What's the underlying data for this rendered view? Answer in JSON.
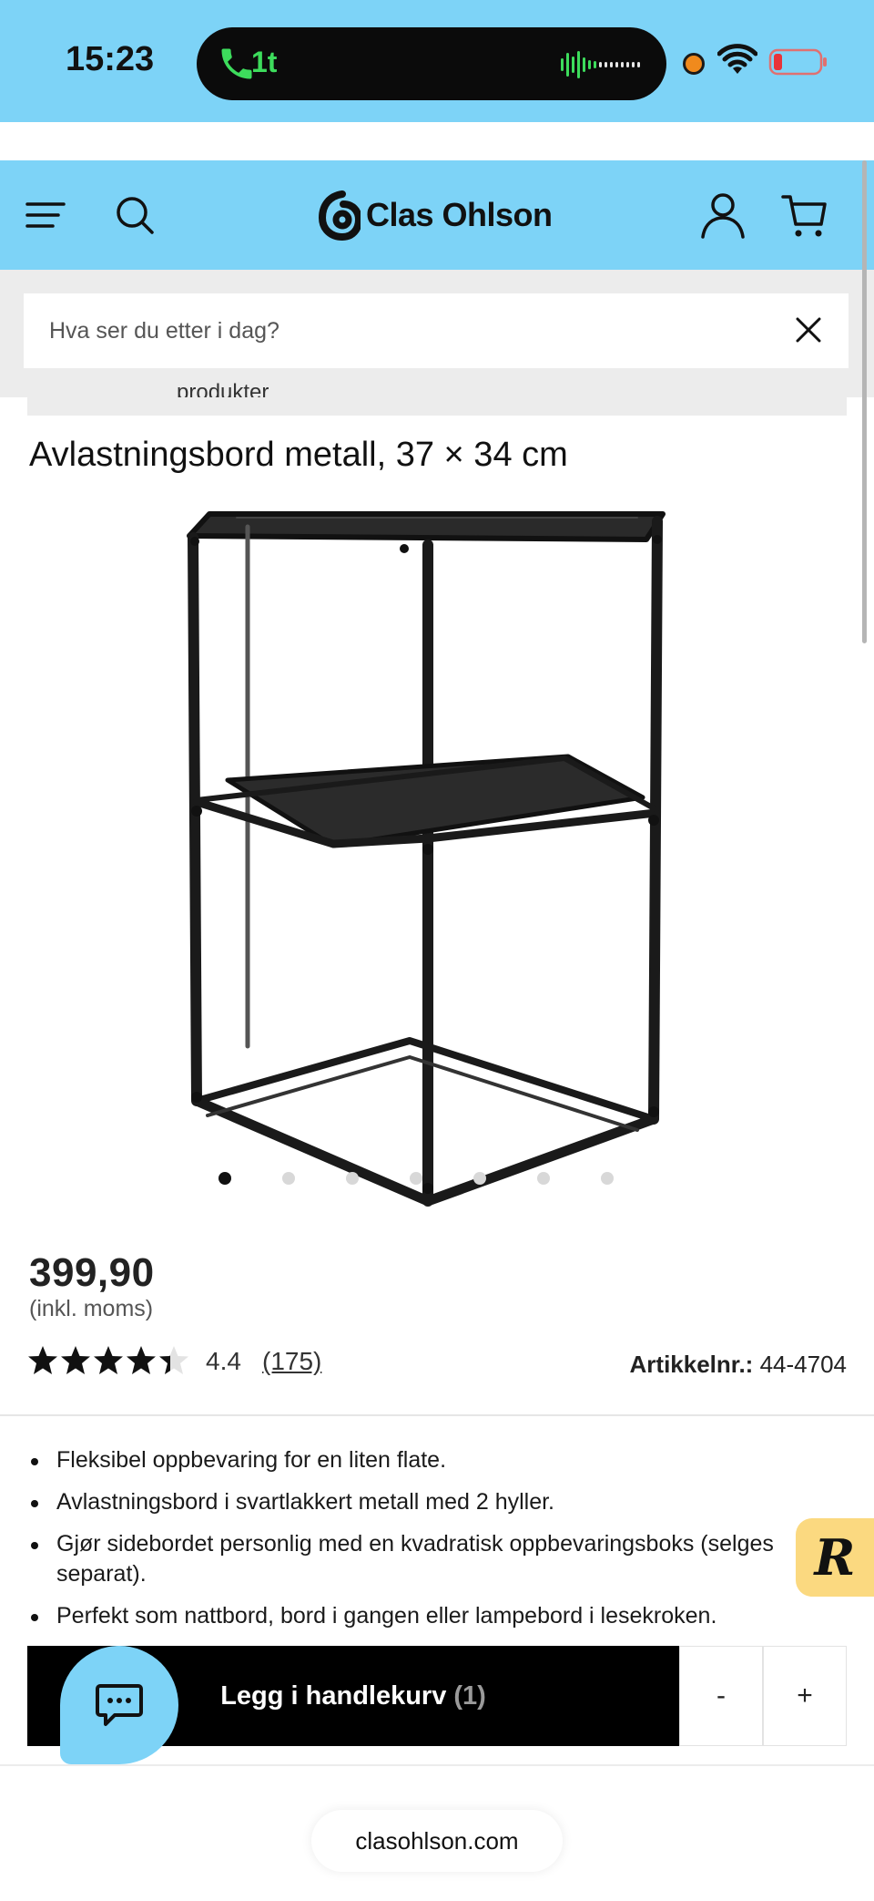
{
  "status_bar": {
    "time": "15:23",
    "call_duration": "1t",
    "icons": [
      "phone-icon",
      "audio-wave-icon",
      "recording-dot-icon",
      "wifi-icon",
      "battery-low-icon"
    ]
  },
  "header": {
    "brand": "Clas Ohlson",
    "icons": [
      "menu-icon",
      "search-icon",
      "account-icon",
      "cart-icon"
    ]
  },
  "search": {
    "placeholder": "Hva ser du etter i dag?",
    "clear_icon": "close-icon",
    "cut_off_suggestion": "produkter"
  },
  "product": {
    "title": "Avlastningsbord metall, 37 × 34 cm",
    "image_count": 7,
    "active_image_index": 0,
    "price": "399,90",
    "vat_note": "(inkl. moms)",
    "rating": "4.4",
    "rating_value": 4.4,
    "review_count": "(175)",
    "article_label": "Artikkelnr.:",
    "article_number": "44-4704",
    "features": [
      "Fleksibel oppbevaring for en liten flate.",
      "Avlastningsbord i svartlakkert metall med 2 hyller.",
      "Gjør sidebordet personlig med en kvadratisk oppbevaringsboks (selges separat).",
      "Perfekt som nattbord, bord i gangen eller lampebord i lesekroken."
    ]
  },
  "cart": {
    "add_label": "Legg i handlekurv",
    "quantity": "(1)",
    "minus": "-",
    "plus": "+"
  },
  "badge_letter": "R",
  "chat_icon": "chat-icon",
  "browser": {
    "url": "clasohlson.com"
  },
  "colors": {
    "brand_blue": "#7dd3f7",
    "badge_yellow": "#fbd980",
    "button_black": "#000000"
  }
}
